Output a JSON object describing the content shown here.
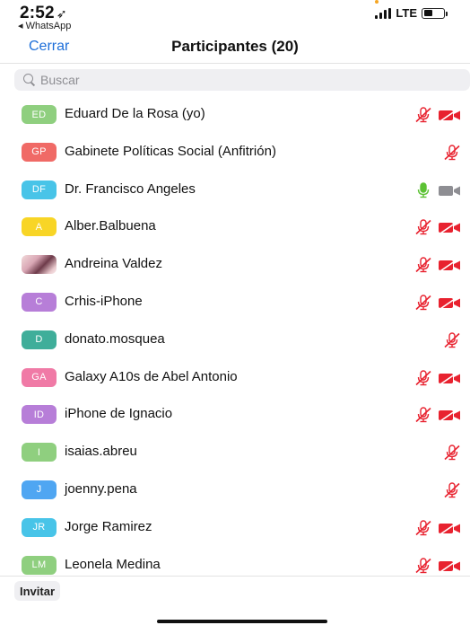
{
  "status_bar": {
    "time": "2:52",
    "back_app": "◂ WhatsApp",
    "network": "LTE",
    "battery_level": 0.45
  },
  "nav": {
    "close_label": "Cerrar",
    "title": "Participantes (20)"
  },
  "search": {
    "placeholder": "Buscar"
  },
  "participants": [
    {
      "initials": "ED",
      "name": "Eduard De la Rosa (yo)",
      "color": "#8fcf7f",
      "mic": "muted",
      "video": "off"
    },
    {
      "initials": "GP",
      "name": "Gabinete Políticas Social (Anfitrión)",
      "color": "#f06a66",
      "mic": "muted",
      "video": "none"
    },
    {
      "initials": "DF",
      "name": "Dr. Francisco Angeles",
      "color": "#48c4e8",
      "mic": "on",
      "video": "on"
    },
    {
      "initials": "A",
      "name": "Alber.Balbuena",
      "color": "#f8d526",
      "mic": "muted",
      "video": "off"
    },
    {
      "initials": "",
      "name": "Andreina Valdez",
      "color": "#d9a7b5",
      "photo": true,
      "mic": "muted",
      "video": "off"
    },
    {
      "initials": "C",
      "name": "Crhis-iPhone",
      "color": "#b77ed8",
      "mic": "muted",
      "video": "off"
    },
    {
      "initials": "D",
      "name": "donato.mosquea",
      "color": "#3fae9a",
      "mic": "muted",
      "video": "none"
    },
    {
      "initials": "GA",
      "name": "Galaxy A10s de Abel Antonio",
      "color": "#f07aa6",
      "mic": "muted",
      "video": "off"
    },
    {
      "initials": "ID",
      "name": "iPhone de Ignacio",
      "color": "#b77ed8",
      "mic": "muted",
      "video": "off"
    },
    {
      "initials": "I",
      "name": "isaias.abreu",
      "color": "#8fcf7f",
      "mic": "muted",
      "video": "none"
    },
    {
      "initials": "J",
      "name": "joenny.pena",
      "color": "#4fa6f2",
      "mic": "muted",
      "video": "none"
    },
    {
      "initials": "JR",
      "name": "Jorge Ramirez",
      "color": "#48c4e8",
      "mic": "muted",
      "video": "off"
    },
    {
      "initials": "LM",
      "name": "Leonela Medina",
      "color": "#8fcf7f",
      "mic": "muted",
      "video": "off"
    }
  ],
  "footer": {
    "invite_label": "Invitar"
  },
  "colors": {
    "accent": "#1e6fd9",
    "muted_red": "#e8222f",
    "mic_on_green": "#5cc234",
    "video_on_gray": "#8e8e93"
  }
}
